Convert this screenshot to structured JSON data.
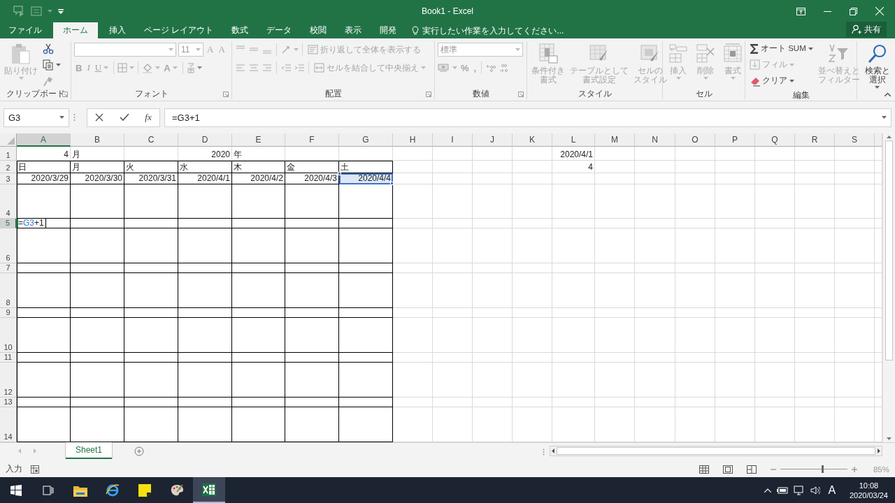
{
  "title_bar": {
    "title": "Book1 - Excel"
  },
  "tabs": [
    {
      "label": "ファイル",
      "selected": false
    },
    {
      "label": "ホーム",
      "selected": true
    },
    {
      "label": "挿入",
      "selected": false
    },
    {
      "label": "ページ レイアウト",
      "selected": false
    },
    {
      "label": "数式",
      "selected": false
    },
    {
      "label": "データ",
      "selected": false
    },
    {
      "label": "校閲",
      "selected": false
    },
    {
      "label": "表示",
      "selected": false
    },
    {
      "label": "開発",
      "selected": false
    }
  ],
  "tell_me": {
    "placeholder": "実行したい作業を入力してください..."
  },
  "share_button": {
    "label": "共有"
  },
  "ribbon": {
    "clipboard": {
      "label": "クリップボード",
      "paste": {
        "label": "貼り付け",
        "disabled": true
      },
      "cut": {
        "disabled": false
      },
      "copy": {
        "disabled": false
      },
      "format_painter": {
        "disabled": true
      }
    },
    "font": {
      "label": "フォント",
      "font_size": {
        "value": "11"
      },
      "grow": {
        "label": "A",
        "disabled": true
      },
      "shrink": {
        "label": "A",
        "disabled": true
      },
      "bold": {
        "label": "B",
        "disabled": true
      },
      "italic": {
        "label": "I",
        "disabled": true
      },
      "underline": {
        "label": "U",
        "disabled": true
      },
      "font_color": {
        "label": "A",
        "disabled": true
      }
    },
    "alignment": {
      "label": "配置",
      "wrap_text": {
        "label": "折り返して全体を表示する",
        "disabled": true
      },
      "merge_center": {
        "label": "セルを結合して中央揃え",
        "disabled": true
      }
    },
    "number": {
      "label": "数値",
      "format": {
        "value": "標準"
      },
      "percent": {
        "label": "%",
        "disabled": true
      },
      "comma": {
        "label": ",",
        "disabled": true
      }
    },
    "styles": {
      "label": "スタイル",
      "buttons": [
        {
          "label_lines": [
            "条件付き",
            "書式"
          ],
          "disabled": true
        },
        {
          "label_lines": [
            "テーブルとして",
            "書式設定"
          ],
          "disabled": true
        },
        {
          "label_lines": [
            "セルの",
            "スタイル"
          ],
          "disabled": true
        }
      ]
    },
    "cells": {
      "label": "セル",
      "buttons": [
        {
          "label": "挿入",
          "disabled": true
        },
        {
          "label": "削除",
          "disabled": true
        },
        {
          "label": "書式",
          "disabled": true
        }
      ]
    },
    "editing": {
      "label": "編集",
      "autosum": {
        "label": "オート SUM",
        "disabled": false
      },
      "fill": {
        "label": "フィル",
        "disabled": true
      },
      "clear": {
        "label": "クリア",
        "disabled": false
      },
      "sort_filter": {
        "label_lines": [
          "並べ替えと",
          "フィルター"
        ],
        "disabled": true
      },
      "find_select": {
        "label_lines": [
          "検索と",
          "選択"
        ],
        "disabled": false
      }
    }
  },
  "formula_bar": {
    "name_box": "G3",
    "function_label": "fx",
    "formula": "=G3+1"
  },
  "sheet": {
    "columns": [
      {
        "label": "A",
        "selected": true
      },
      {
        "label": "B",
        "selected": false
      },
      {
        "label": "C",
        "selected": false
      },
      {
        "label": "D",
        "selected": false
      },
      {
        "label": "E",
        "selected": false
      },
      {
        "label": "F",
        "selected": false
      },
      {
        "label": "G",
        "selected": false
      },
      {
        "label": "H",
        "selected": false
      },
      {
        "label": "I",
        "selected": false
      },
      {
        "label": "J",
        "selected": false
      },
      {
        "label": "K",
        "selected": false
      },
      {
        "label": "L",
        "selected": false
      },
      {
        "label": "M",
        "selected": false
      },
      {
        "label": "N",
        "selected": false
      },
      {
        "label": "O",
        "selected": false
      },
      {
        "label": "P",
        "selected": false
      },
      {
        "label": "Q",
        "selected": false
      },
      {
        "label": "R",
        "selected": false
      },
      {
        "label": "S",
        "selected": false
      }
    ],
    "rows": [
      {
        "label": "1",
        "selected": false,
        "bordered": false,
        "cells": [
          {
            "kind": "number",
            "text": "4",
            "selected": false
          },
          {
            "kind": "text",
            "text": "月",
            "selected": false
          },
          null,
          {
            "kind": "number",
            "text": "2020",
            "selected": false
          },
          {
            "kind": "text",
            "text": "年",
            "selected": false
          },
          null,
          null,
          null,
          null,
          null,
          null,
          {
            "kind": "number",
            "text": "2020/4/1",
            "selected": false
          }
        ]
      },
      {
        "label": "2",
        "selected": false,
        "bordered": true,
        "cells": [
          {
            "kind": "text",
            "text": "日",
            "selected": false
          },
          {
            "kind": "text",
            "text": "月",
            "selected": false
          },
          {
            "kind": "text",
            "text": "火",
            "selected": false
          },
          {
            "kind": "text",
            "text": "水",
            "selected": false
          },
          {
            "kind": "text",
            "text": "木",
            "selected": false
          },
          {
            "kind": "text",
            "text": "金",
            "selected": false
          },
          {
            "kind": "text",
            "text": "土",
            "selected": false
          },
          null,
          null,
          null,
          null,
          {
            "kind": "number",
            "text": "4",
            "selected": false
          }
        ]
      },
      {
        "label": "3",
        "selected": false,
        "bordered": true,
        "cells": [
          {
            "kind": "number",
            "text": "2020/3/29",
            "selected": false
          },
          {
            "kind": "number",
            "text": "2020/3/30",
            "selected": false
          },
          {
            "kind": "number",
            "text": "2020/3/31",
            "selected": false
          },
          {
            "kind": "number",
            "text": "2020/4/1",
            "selected": false
          },
          {
            "kind": "number",
            "text": "2020/4/2",
            "selected": false
          },
          {
            "kind": "number",
            "text": "2020/4/3",
            "selected": false
          },
          {
            "kind": "number",
            "text": "2020/4/4",
            "selected": true
          }
        ]
      },
      {
        "label": "4",
        "selected": false,
        "bordered": true
      },
      {
        "label": "5",
        "selected": true,
        "bordered": true,
        "cells": [
          {
            "kind": "editing",
            "parts": [
              "=",
              "G3",
              "+1"
            ],
            "selected": false
          }
        ]
      },
      {
        "label": "6",
        "selected": false,
        "bordered": true
      },
      {
        "label": "7",
        "selected": false,
        "bordered": true
      },
      {
        "label": "8",
        "selected": false,
        "bordered": true
      },
      {
        "label": "9",
        "selected": false,
        "bordered": true
      },
      {
        "label": "10",
        "selected": false,
        "bordered": true
      },
      {
        "label": "11",
        "selected": false,
        "bordered": true
      },
      {
        "label": "12",
        "selected": false,
        "bordered": true
      },
      {
        "label": "13",
        "selected": false,
        "bordered": true
      },
      {
        "label": "14",
        "selected": false,
        "bordered": true
      }
    ]
  },
  "sheet_tabs": [
    {
      "label": "Sheet1",
      "selected": true
    }
  ],
  "status_bar": {
    "mode": "入力",
    "zoom": {
      "level": 0.62,
      "reading": "85%"
    }
  },
  "taskbar": {
    "ime": "A",
    "time": "10:08",
    "date": "2020/03/24"
  }
}
